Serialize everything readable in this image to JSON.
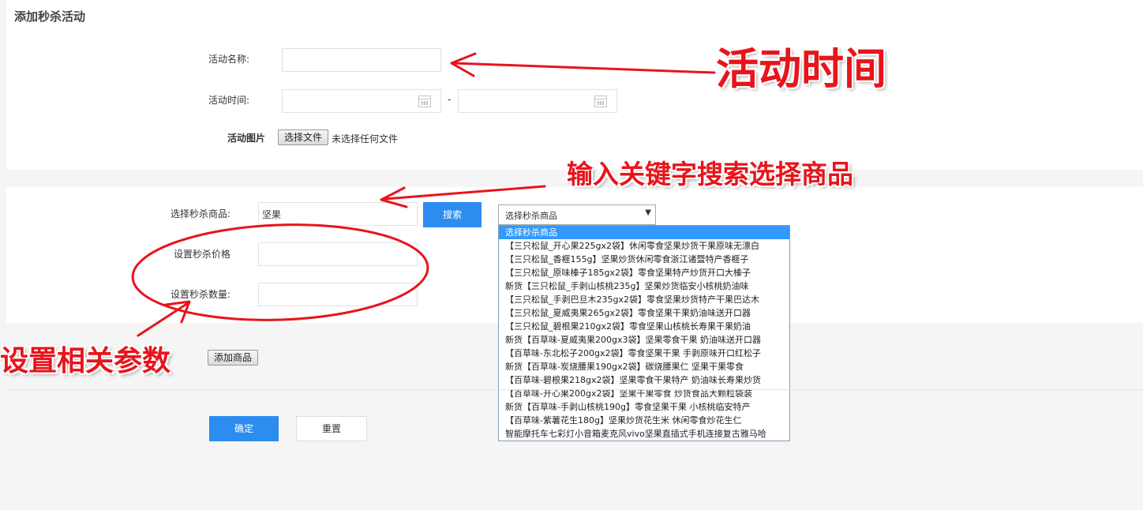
{
  "page_title": "添加秒杀活动",
  "form": {
    "name_label": "活动名称:",
    "time_label": "活动时间:",
    "time_sep": "-",
    "image_label": "活动图片",
    "file_button": "选择文件",
    "file_status": "未选择任何文件",
    "product_label": "选择秒杀商品:",
    "search_value": "坚果",
    "search_button": "搜索",
    "select_value": "选择秒杀商品",
    "price_label": "设置秒杀价格",
    "qty_label": "设置秒杀数量:",
    "add_button": "添加商品",
    "confirm_button": "确定",
    "reset_button": "重置"
  },
  "dropdown_options": [
    "选择秒杀商品",
    "【三只松鼠_开心果225gx2袋】休闲零食坚果炒货干果原味无漂白",
    "【三只松鼠_香榧155g】坚果炒货休闲零食浙江诸暨特产香榧子",
    "【三只松鼠_原味榛子185gx2袋】零食坚果特产炒货开口大榛子",
    "新货【三只松鼠_手剥山核桃235g】坚果炒货临安小核桃奶油味",
    "【三只松鼠_手剥巴旦木235gx2袋】零食坚果炒货特产干果巴达木",
    "【三只松鼠_夏威夷果265gx2袋】零食坚果干果奶油味送开口器",
    "【三只松鼠_碧根果210gx2袋】零食坚果山核桃长寿果干果奶油",
    "新货【百草味-夏威夷果200gx3袋】坚果零食干果 奶油味送开口器",
    "【百草味-东北松子200gx2袋】零食坚果干果 手剥原味开口红松子",
    "新货【百草味-炭烧腰果190gx2袋】碳烧腰果仁 坚果干果零食",
    "【百草味-碧根果218gx2袋】坚果零食干果特产 奶油味长寿果炒货",
    "【百草味-开心果200gx2袋】坚果干果零食 炒货食品大颗粒袋装",
    "新货【百草味-手剥山核桃190g】零食坚果干果 小核桃临安特产",
    "【百草味-紫薯花生180g】坚果炒货花生米 休闲零食炒花生仁",
    "智能摩托车七彩灯小音箱麦克风vivo坚果直插式手机连接复古雅马哈"
  ],
  "annotations": {
    "time_note": "活动时间",
    "search_note": "输入关键字搜索选择商品",
    "params_note": "设置相关参数",
    "color": "#e8141c"
  },
  "colors": {
    "primary": "#2d8cf0",
    "select_highlight": "#3399ff"
  }
}
